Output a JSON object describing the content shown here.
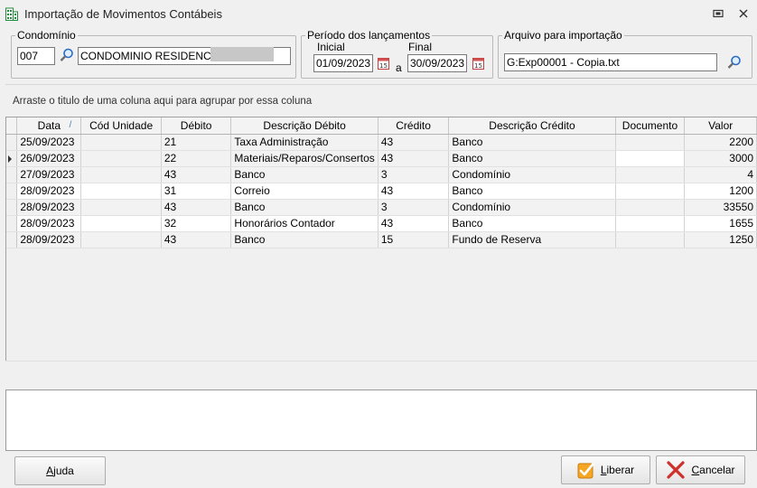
{
  "window": {
    "title": "Importação de Movimentos Contábeis"
  },
  "condominio": {
    "legend": "Condomínio",
    "code": "007",
    "name": "CONDOMINIO RESIDENCIAL"
  },
  "periodo": {
    "legend": "Período dos lançamentos",
    "label_inicial": "Inicial",
    "label_final": "Final",
    "inicial": "01/09/2023",
    "final": "30/09/2023",
    "sep": "a"
  },
  "arquivo": {
    "legend": "Arquivo para importação",
    "value": "G:Exp00001 - Copia.txt"
  },
  "group_hint": "Arraste o titulo de uma coluna aqui para agrupar por essa coluna",
  "grid": {
    "columns": [
      "Data",
      "Cód Unidade",
      "Débito",
      "Descrição Débito",
      "Crédito",
      "Descrição Crédito",
      "Documento",
      "Valor"
    ],
    "sort_indicator": "/",
    "rows": [
      {
        "data": "25/09/2023",
        "cod_unidade": "",
        "debito": "21",
        "desc_debito": "Taxa Administração",
        "credito": "43",
        "desc_credito": "Banco",
        "documento": "",
        "valor": "2200"
      },
      {
        "data": "26/09/2023",
        "cod_unidade": "",
        "debito": "22",
        "desc_debito": "Materiais/Reparos/Consertos",
        "credito": "43",
        "desc_credito": "Banco",
        "documento": "",
        "valor": "3000"
      },
      {
        "data": "27/09/2023",
        "cod_unidade": "",
        "debito": "43",
        "desc_debito": "Banco",
        "credito": "3",
        "desc_credito": "Condomínio",
        "documento": "",
        "valor": "4"
      },
      {
        "data": "28/09/2023",
        "cod_unidade": "",
        "debito": "31",
        "desc_debito": "Correio",
        "credito": "43",
        "desc_credito": "Banco",
        "documento": "",
        "valor": "1200"
      },
      {
        "data": "28/09/2023",
        "cod_unidade": "",
        "debito": "43",
        "desc_debito": "Banco",
        "credito": "3",
        "desc_credito": "Condomínio",
        "documento": "",
        "valor": "33550"
      },
      {
        "data": "28/09/2023",
        "cod_unidade": "",
        "debito": "32",
        "desc_debito": "Honorários Contador",
        "credito": "43",
        "desc_credito": "Banco",
        "documento": "",
        "valor": "1655"
      },
      {
        "data": "28/09/2023",
        "cod_unidade": "",
        "debito": "43",
        "desc_debito": "Banco",
        "credito": "15",
        "desc_credito": "Fundo  de Reserva",
        "documento": "",
        "valor": "1250"
      }
    ]
  },
  "memo": "",
  "buttons": {
    "ajuda": {
      "first": "A",
      "rest": "juda"
    },
    "liberar": {
      "first": "L",
      "rest": "iberar"
    },
    "cancelar": {
      "first": "C",
      "rest": "ancelar"
    }
  }
}
